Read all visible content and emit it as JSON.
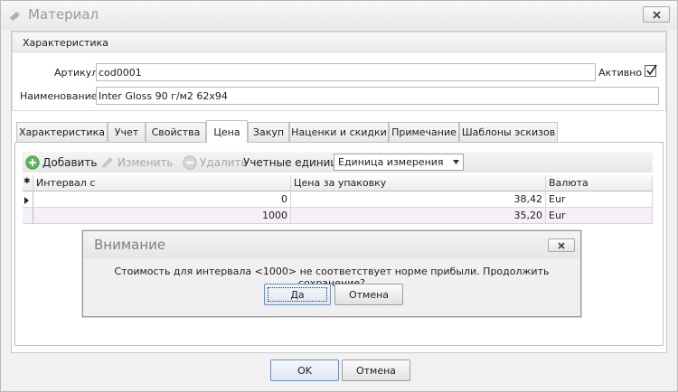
{
  "window": {
    "title": "Материал"
  },
  "characteristics": {
    "header": "Характеристика",
    "article_label": "Артикул:",
    "article_value": "cod0001",
    "active_label": "Активно",
    "active_checked": true,
    "name_label": "Наименование:",
    "name_value": "Inter Gloss 90 г/м2 62х94"
  },
  "tabs": [
    {
      "label": "Характеристика"
    },
    {
      "label": "Учет"
    },
    {
      "label": "Свойства"
    },
    {
      "label": "Цена",
      "active": true
    },
    {
      "label": "Закуп"
    },
    {
      "label": "Наценки и скидки"
    },
    {
      "label": "Примечание"
    },
    {
      "label": "Шаблоны эскизов"
    }
  ],
  "toolbar": {
    "add_label": "Добавить",
    "edit_label": "Изменить",
    "delete_label": "Удалить",
    "units_label": "Учетные единицы:",
    "units_value": "Единица измерения"
  },
  "grid": {
    "columns": [
      "Интервал с",
      "Цена за упаковку",
      "Валюта"
    ],
    "rows": [
      {
        "interval": "0",
        "price": "38,42",
        "currency": "Eur"
      },
      {
        "interval": "1000",
        "price": "35,20",
        "currency": "Eur"
      }
    ]
  },
  "dialog": {
    "title": "Внимание",
    "message": "Стоимость для интервала <1000> не соответствует норме прибыли. Продолжить сохранение?",
    "yes_label": "Да",
    "cancel_label": "Отмена"
  },
  "footer": {
    "ok_label": "OK",
    "cancel_label": "Отмена"
  },
  "colors": {
    "add_icon_green": "#5cb85c",
    "disabled_text": "#a8a8a8",
    "row_alt": "#f5f0f8"
  }
}
